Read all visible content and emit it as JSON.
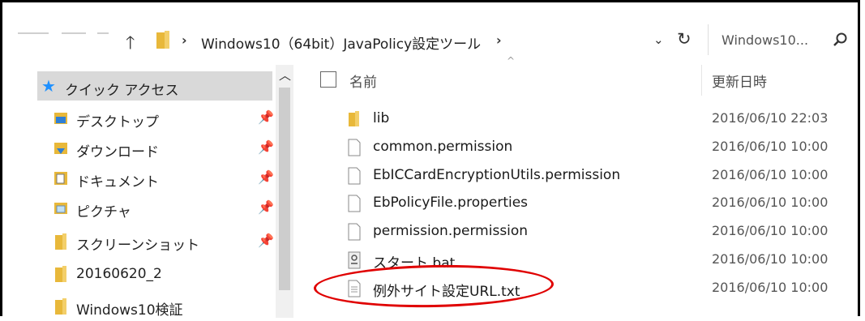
{
  "address_bar": {
    "path_segments": [
      "Windows10（64bit）JavaPolicy設定ツール"
    ],
    "search_placeholder": "Windows10..."
  },
  "nav_pane": {
    "quick_access": "クイック アクセス",
    "items": [
      {
        "label": "デスクトップ",
        "icon": "desktop-folder-icon",
        "pinned": true
      },
      {
        "label": "ダウンロード",
        "icon": "download-folder-icon",
        "pinned": true
      },
      {
        "label": "ドキュメント",
        "icon": "documents-folder-icon",
        "pinned": true
      },
      {
        "label": "ピクチャ",
        "icon": "pictures-folder-icon",
        "pinned": true
      },
      {
        "label": "スクリーンショット",
        "icon": "folder-icon",
        "pinned": true
      },
      {
        "label": "20160620_2",
        "icon": "folder-icon",
        "pinned": false
      },
      {
        "label": "Windows10検証",
        "icon": "folder-icon",
        "pinned": false
      }
    ]
  },
  "file_list": {
    "col_name": "名前",
    "col_date": "更新日時",
    "rows": [
      {
        "name": "lib",
        "date": "2016/06/10 22:03",
        "icon": "folder-icon"
      },
      {
        "name": "common.permission",
        "date": "2016/06/10 10:00",
        "icon": "file-icon"
      },
      {
        "name": "EbICCardEncryptionUtils.permission",
        "date": "2016/06/10 10:00",
        "icon": "file-icon"
      },
      {
        "name": "EbPolicyFile.properties",
        "date": "2016/06/10 10:00",
        "icon": "file-icon"
      },
      {
        "name": "permission.permission",
        "date": "2016/06/10 10:00",
        "icon": "file-icon"
      },
      {
        "name": "スタート.bat",
        "date": "2016/06/10 10:00",
        "icon": "batch-file-icon"
      },
      {
        "name": "例外サイト設定URL.txt",
        "date": "2016/06/10 10:00",
        "icon": "text-file-icon"
      }
    ]
  },
  "colors": {
    "folder": "#e8b83a",
    "selection": "#d9d9d9",
    "highlight": "#e00000"
  }
}
